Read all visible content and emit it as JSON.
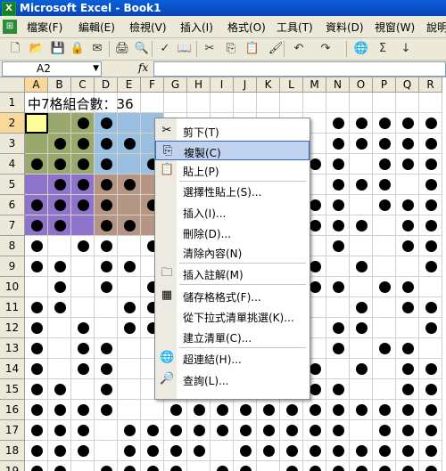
{
  "window": {
    "title": "Microsoft Excel - Book1",
    "app_icon": "excel-icon"
  },
  "menu": {
    "items": [
      {
        "label": "檔案(F)"
      },
      {
        "label": "編輯(E)"
      },
      {
        "label": "檢視(V)"
      },
      {
        "label": "插入(I)"
      },
      {
        "label": "格式(O)"
      },
      {
        "label": "工具(T)"
      },
      {
        "label": "資料(D)"
      },
      {
        "label": "視窗(W)"
      },
      {
        "label": "說明"
      }
    ]
  },
  "toolbar": {
    "buttons": [
      {
        "icon": "new-icon",
        "glyph": "🗋"
      },
      {
        "icon": "open-icon",
        "glyph": "📂"
      },
      {
        "icon": "save-icon",
        "glyph": "💾"
      },
      {
        "icon": "permission-icon",
        "glyph": "🔒"
      },
      {
        "icon": "email-icon",
        "glyph": "✉"
      },
      {
        "icon": "print-icon",
        "glyph": "🖨"
      },
      {
        "icon": "print-preview-icon",
        "glyph": "🔍"
      },
      {
        "icon": "spelling-icon",
        "glyph": "✓"
      },
      {
        "icon": "research-icon",
        "glyph": "📖"
      },
      {
        "icon": "cut-icon",
        "glyph": "✂"
      },
      {
        "icon": "copy-icon",
        "glyph": "⎘"
      },
      {
        "icon": "paste-icon",
        "glyph": "📋"
      },
      {
        "icon": "format-painter-icon",
        "glyph": "🖌"
      },
      {
        "icon": "undo-icon",
        "glyph": "↶"
      },
      {
        "icon": "redo-icon",
        "glyph": "↷"
      },
      {
        "icon": "hyperlink-icon",
        "glyph": "🌐"
      },
      {
        "icon": "autosum-icon",
        "glyph": "Σ"
      },
      {
        "icon": "sort-ascending-icon",
        "glyph": "↓"
      }
    ]
  },
  "formula_bar": {
    "name_box": "A2",
    "fx_label": "fx",
    "value": ""
  },
  "sheet": {
    "columns": [
      "A",
      "B",
      "C",
      "D",
      "E",
      "F",
      "G",
      "H",
      "I",
      "J",
      "K",
      "L",
      "M",
      "N",
      "O",
      "P",
      "Q",
      "R"
    ],
    "rows": [
      "1",
      "2",
      "3",
      "4",
      "5",
      "6",
      "7",
      "8",
      "9",
      "10",
      "11",
      "12",
      "13",
      "14",
      "15",
      "16",
      "17",
      "18",
      "19"
    ],
    "a1_text": "中7格組合數：36",
    "highlight_colors": {
      "yellow": "#ffff99",
      "olive": "#99a86c",
      "blue": "#99c0e0",
      "purple": "#8d73c9",
      "tan": "#b59584"
    }
  },
  "context_menu": {
    "items": [
      {
        "label": "剪下(T)",
        "icon": "cut-icon"
      },
      {
        "label": "複製(C)",
        "icon": "copy-icon",
        "highlighted": true
      },
      {
        "label": "貼上(P)",
        "icon": "paste-icon"
      },
      {
        "label": "選擇性貼上(S)...",
        "icon": ""
      },
      {
        "label": "插入(I)...",
        "icon": ""
      },
      {
        "label": "刪除(D)...",
        "icon": ""
      },
      {
        "label": "清除內容(N)",
        "icon": ""
      },
      {
        "label": "插入註解(M)",
        "icon": "comment-icon"
      },
      {
        "label": "儲存格格式(F)...",
        "icon": "format-cells-icon"
      },
      {
        "label": "從下拉式清單挑選(K)...",
        "icon": ""
      },
      {
        "label": "建立清單(C)...",
        "icon": ""
      },
      {
        "label": "超連結(H)...",
        "icon": "hyperlink-icon"
      },
      {
        "label": "查詢(L)...",
        "icon": "lookup-icon"
      }
    ]
  }
}
